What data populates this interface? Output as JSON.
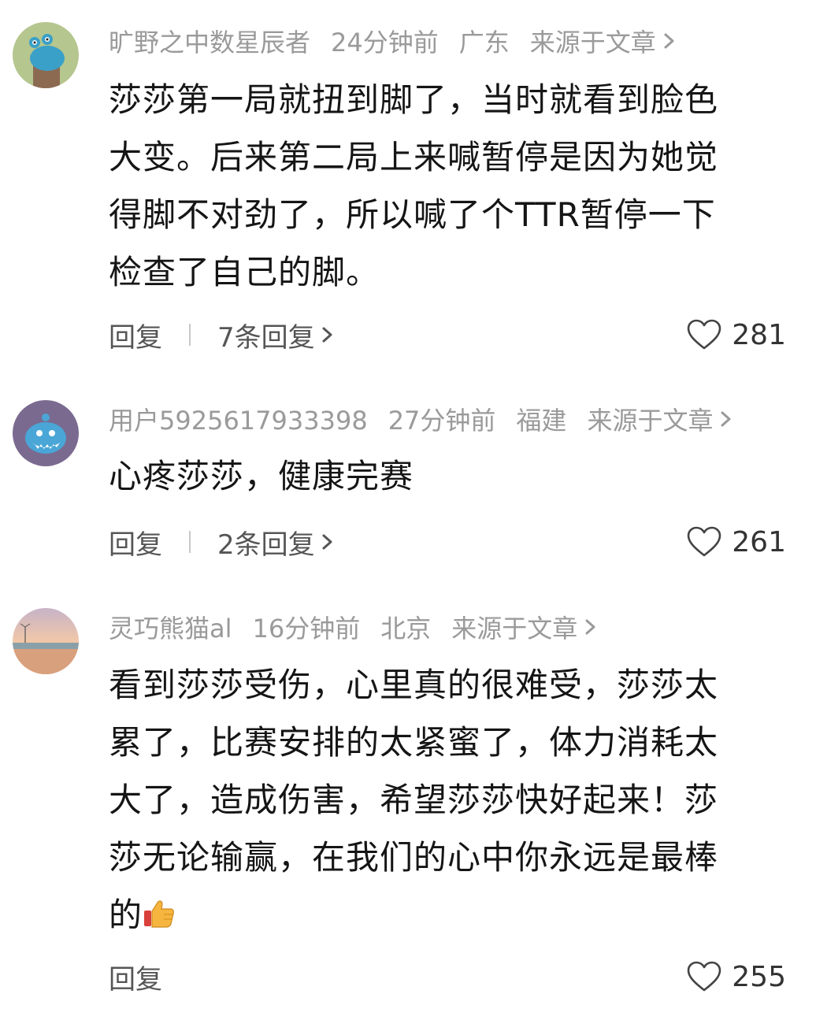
{
  "comments": [
    {
      "username": "旷野之中数星辰者",
      "time": "24分钟前",
      "location": "广东",
      "source": "来源于文章",
      "lines": [
        "莎莎第一局就扭到脚了，当时就看到脸色",
        "大变。后来第二局上来喊暂停是因为她觉",
        "得脚不对劲了，所以喊了个TTR暂停一下",
        "检查了自己的脚。"
      ],
      "reply_label": "回复",
      "replies_label": "7条回复",
      "likes": "281",
      "avatar_icon": "cartoon-creature-avatar"
    },
    {
      "username": "用户5925617933398",
      "time": "27分钟前",
      "location": "福建",
      "source": "来源于文章",
      "lines": [
        "心疼莎莎，健康完赛"
      ],
      "reply_label": "回复",
      "replies_label": "2条回复",
      "likes": "261",
      "avatar_icon": "blue-monster-avatar"
    },
    {
      "username": "灵巧熊猫al",
      "time": "16分钟前",
      "location": "北京",
      "source": "来源于文章",
      "lines": [
        "看到莎莎受伤，心里真的很难受，莎莎太",
        "累了，比赛安排的太紧蜜了，体力消耗太",
        "大了，造成伤害，希望莎莎快好起来！莎",
        "莎无论输赢，在我们的心中你永远是最棒",
        "的"
      ],
      "reply_label": "回复",
      "likes": "255",
      "avatar_icon": "sunset-beach-avatar",
      "trailing_emoji": "thumbs-up-icon"
    }
  ],
  "colors": {
    "meta_text": "#9a9a9a",
    "body_text": "#151515",
    "action_text": "#555555"
  }
}
